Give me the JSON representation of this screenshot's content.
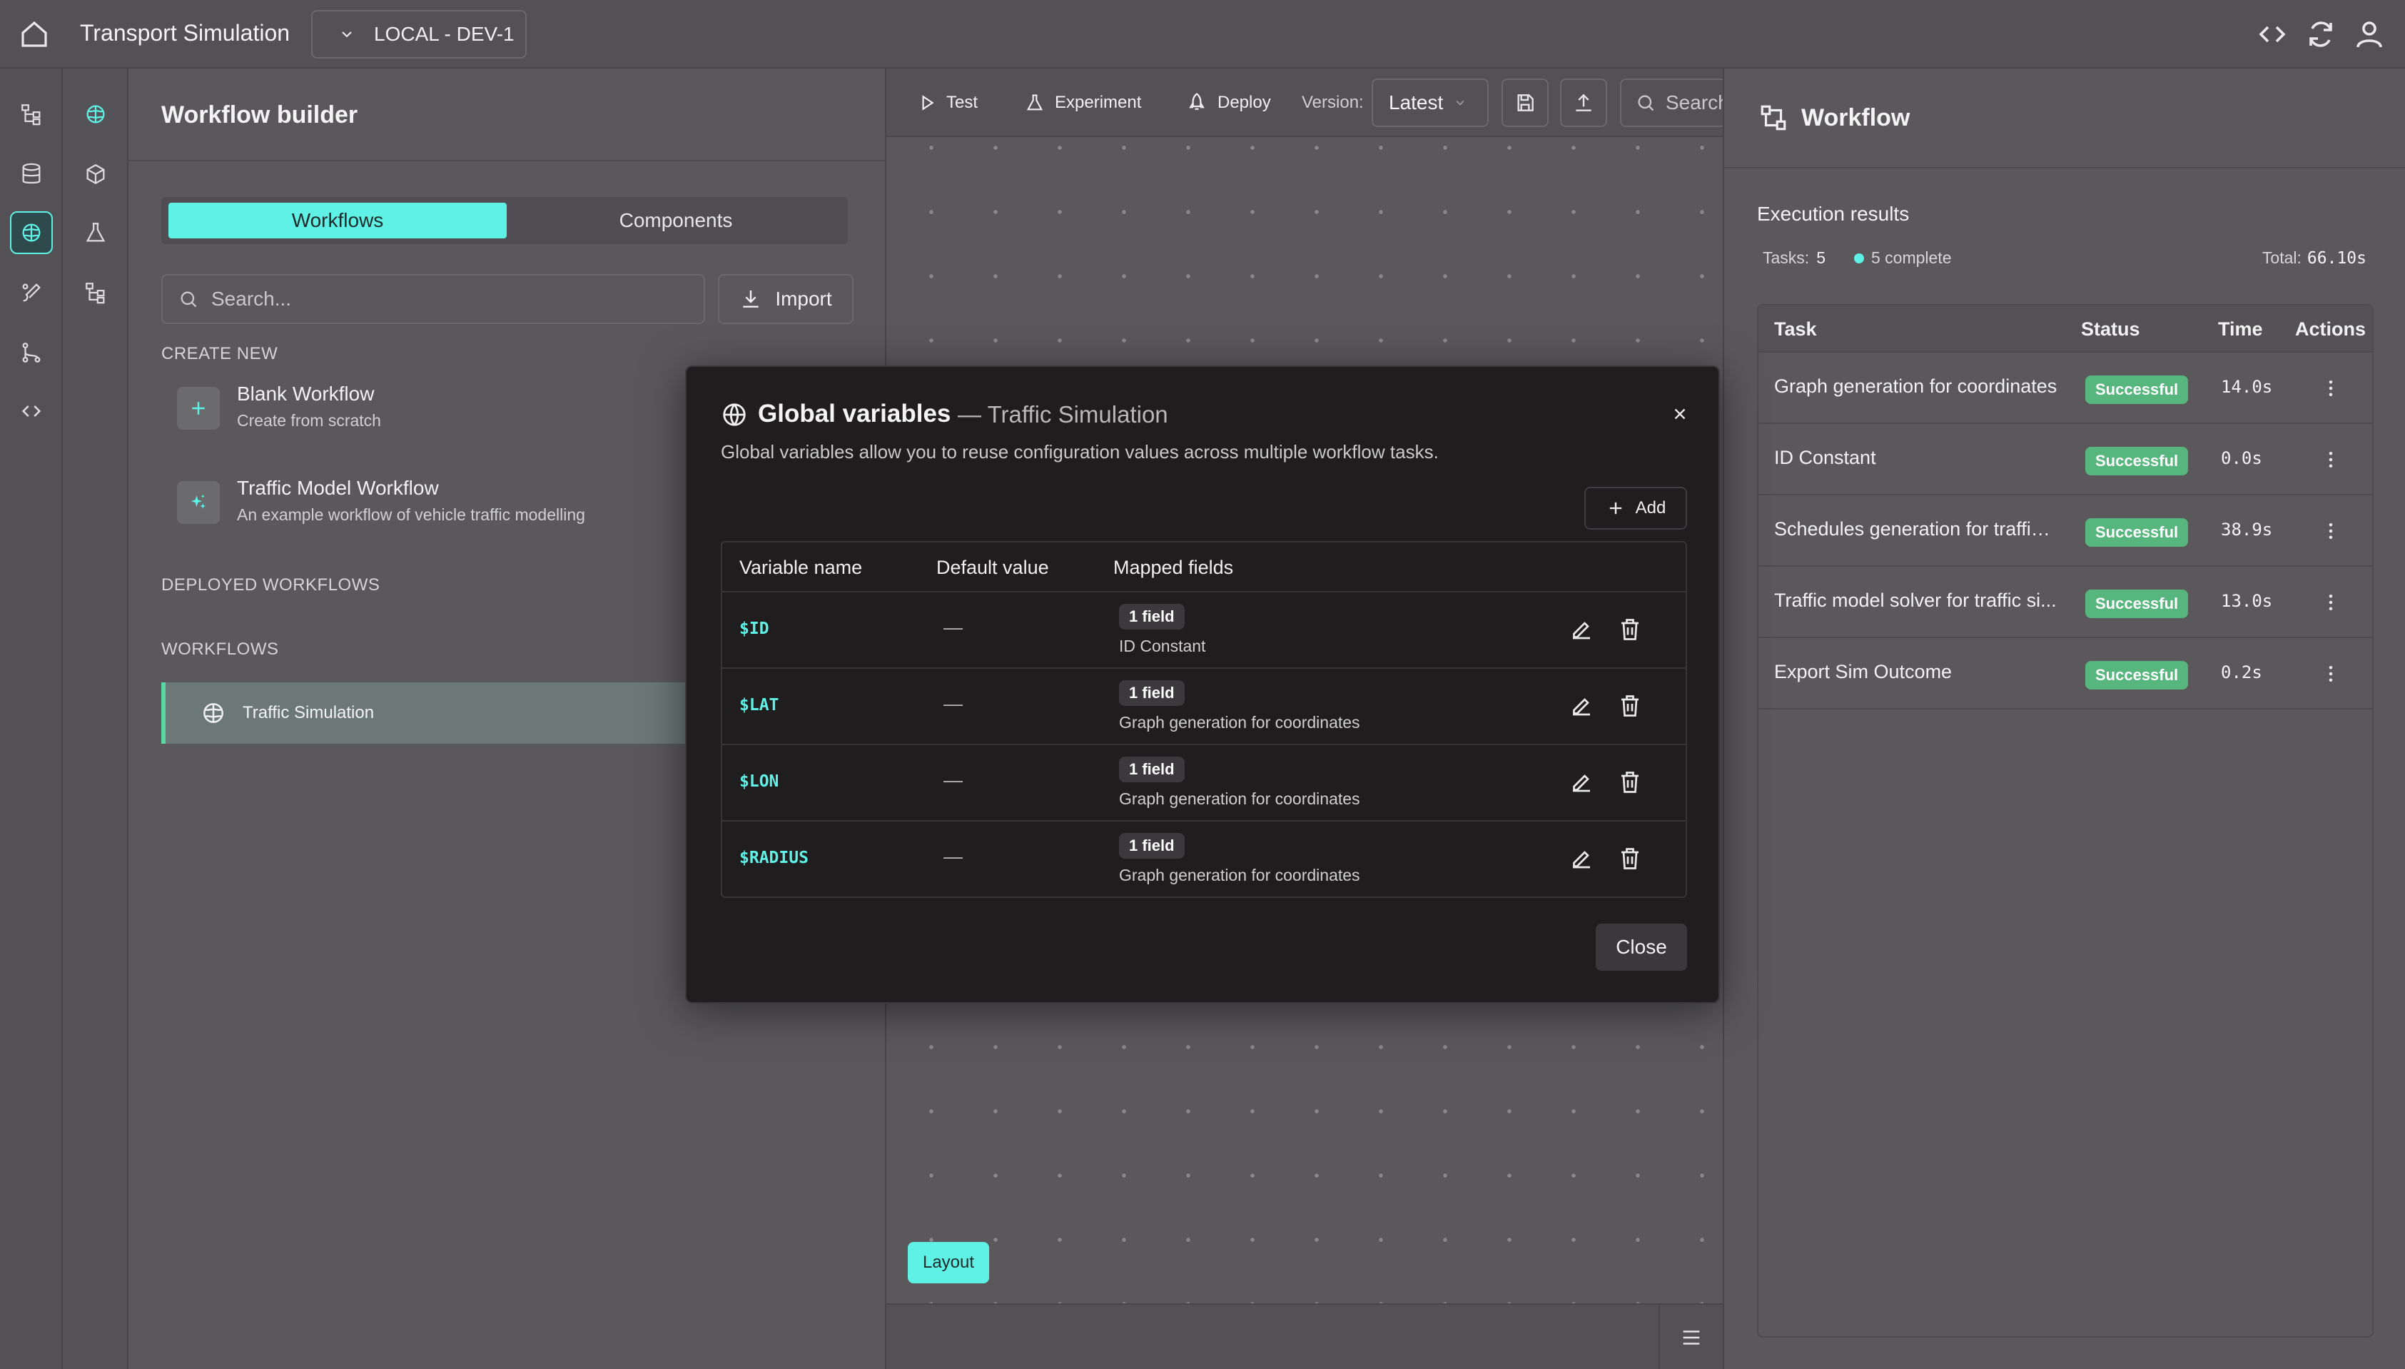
{
  "app": {
    "title": "Transport Simulation",
    "environment": "LOCAL - DEV-1"
  },
  "builder": {
    "title": "Workflow builder",
    "tabs": {
      "workflows": "Workflows",
      "components": "Components"
    },
    "search_placeholder": "Search...",
    "import_label": "Import",
    "create_new_label": "CREATE NEW",
    "create_items": [
      {
        "title": "Blank Workflow",
        "subtitle": "Create from scratch",
        "icon": "plus-icon"
      },
      {
        "title": "Traffic Model Workflow",
        "subtitle": "An example workflow of vehicle traffic modelling",
        "icon": "sparkle-icon"
      }
    ],
    "deployed_label": "DEPLOYED WORKFLOWS",
    "workflows_label": "WORKFLOWS",
    "workflows": [
      {
        "name": "Traffic Simulation",
        "icon": "brain-icon"
      }
    ]
  },
  "toolbar": {
    "test_label": "Test",
    "experiment_label": "Experiment",
    "deploy_label": "Deploy",
    "version_label": "Version:",
    "version_value": "Latest",
    "search_placeholder": "Search"
  },
  "canvas": {
    "layout_label": "Layout"
  },
  "right": {
    "title": "Workflow",
    "execution_title": "Execution results",
    "tasks_label": "Tasks:",
    "tasks_count": "5",
    "complete_label": "5 complete",
    "total_label": "Total:",
    "total_value": "66.10s",
    "columns": {
      "task": "Task",
      "status": "Status",
      "time": "Time",
      "actions": "Actions"
    },
    "rows": [
      {
        "task": "Graph generation for coordinates",
        "status": "Successful",
        "time": "14.0s"
      },
      {
        "task": "ID Constant",
        "status": "Successful",
        "time": "0.0s"
      },
      {
        "task": "Schedules generation for traffic ...",
        "status": "Successful",
        "time": "38.9s"
      },
      {
        "task": "Traffic model solver for traffic si...",
        "status": "Successful",
        "time": "13.0s"
      },
      {
        "task": "Export Sim Outcome",
        "status": "Successful",
        "time": "0.2s"
      }
    ],
    "status_color": "#57b67e"
  },
  "modal": {
    "title": "Global variables",
    "subtitle": "— Traffic Simulation",
    "description": "Global variables allow you to reuse configuration values across multiple workflow tasks.",
    "add_label": "Add",
    "columns": {
      "name": "Variable name",
      "default": "Default value",
      "mapped": "Mapped fields"
    },
    "rows": [
      {
        "name": "$ID",
        "default": "—",
        "badge": "1 field",
        "mapped": "ID Constant"
      },
      {
        "name": "$LAT",
        "default": "—",
        "badge": "1 field",
        "mapped": "Graph generation for coordinates"
      },
      {
        "name": "$LON",
        "default": "—",
        "badge": "1 field",
        "mapped": "Graph generation for coordinates"
      },
      {
        "name": "$RADIUS",
        "default": "—",
        "badge": "1 field",
        "mapped": "Graph generation for coordinates"
      }
    ],
    "close_label": "Close"
  },
  "colors": {
    "accent": "#5ff1e6",
    "success": "#57b67e",
    "modal_bg": "#1f1d1e"
  }
}
